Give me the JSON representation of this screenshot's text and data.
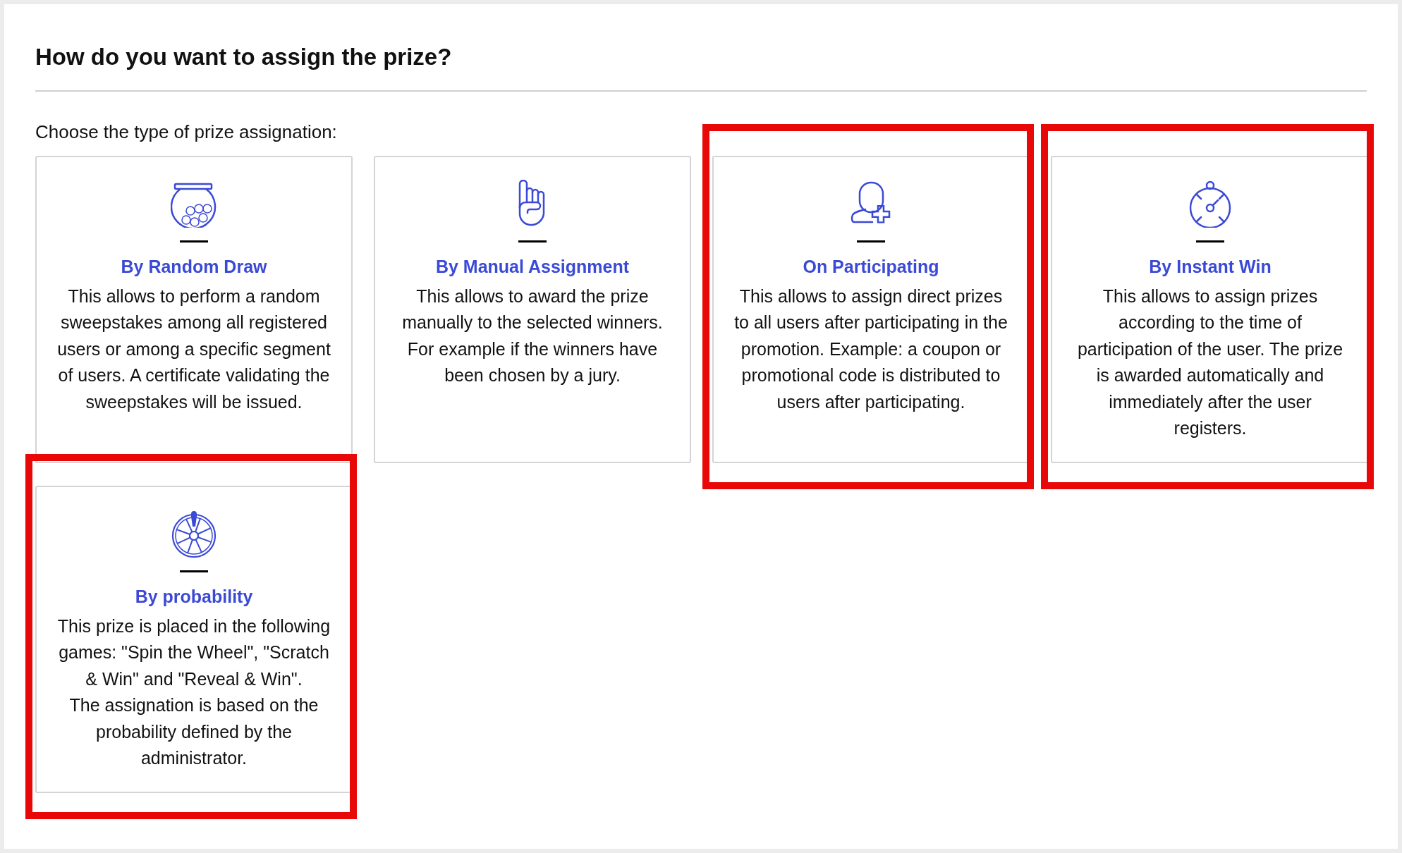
{
  "heading": "How do you want to assign the prize?",
  "subtitle": "Choose the type of prize assignation:",
  "options": [
    {
      "title": "By Random Draw",
      "highlighted": false,
      "description": [
        "This allows to perform a random sweepstakes among all registered users or among a specific segment of users. A certificate validating the sweepstakes will be issued."
      ]
    },
    {
      "title": "By Manual Assignment",
      "highlighted": false,
      "description": [
        "This allows to award the prize manually to the selected winners. For example if the winners have been chosen by a jury."
      ]
    },
    {
      "title": "On Participating",
      "highlighted": true,
      "description": [
        "This allows to assign direct prizes to all users after participating in the promotion. Example: a coupon or promotional code is distributed to users after participating."
      ]
    },
    {
      "title": "By Instant Win",
      "highlighted": true,
      "description": [
        "This allows to assign prizes according to the time of participation of the user. The prize is awarded automatically and immediately after the user registers."
      ]
    },
    {
      "title": "By probability",
      "highlighted": true,
      "description": [
        "This prize is placed in the following games: \"Spin the Wheel\", \"Scratch & Win\" and \"Reveal & Win\".",
        "The assignation is based on the probability defined by the administrator."
      ]
    }
  ]
}
